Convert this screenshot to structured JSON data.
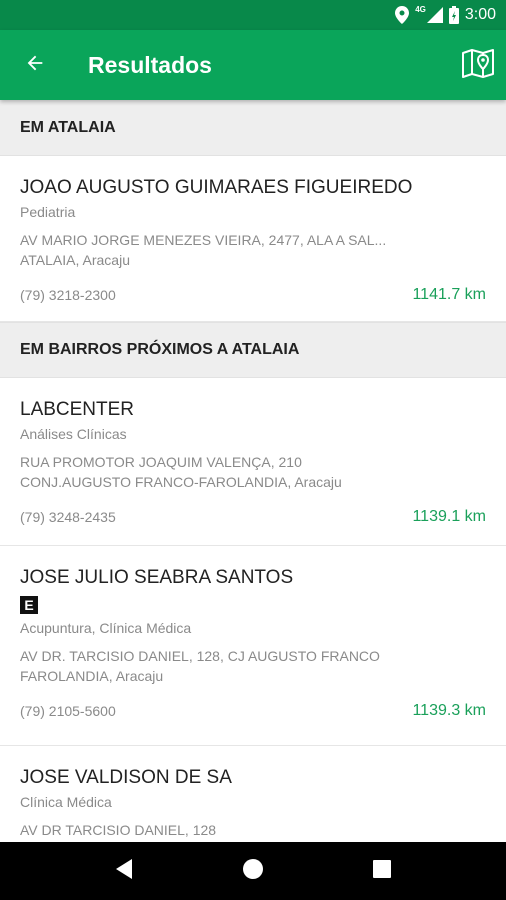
{
  "status_bar": {
    "time": "3:00",
    "network": "4G"
  },
  "app_bar": {
    "title": "Resultados",
    "back_icon": "arrow-back-icon",
    "map_icon": "map-icon",
    "color": "#0aa55a"
  },
  "sections": [
    {
      "header": "EM ATALAIA",
      "items": [
        {
          "name": "JOAO AUGUSTO GUIMARAES FIGUEIREDO",
          "specialty": "Pediatria",
          "address_line1": "AV MARIO JORGE MENEZES VIEIRA, 2477, ALA A     SAL...",
          "address_line2": "ATALAIA, Aracaju",
          "phone": "(79) 3218-2300",
          "distance": "1141.7 km"
        }
      ]
    },
    {
      "header": "EM BAIRROS PRÓXIMOS A ATALAIA",
      "items": [
        {
          "name": "LABCENTER",
          "specialty": "Análises Clínicas",
          "address_line1": "RUA PROMOTOR JOAQUIM VALENÇA, 210",
          "address_line2": "CONJ.AUGUSTO FRANCO-FAROLANDIA, Aracaju",
          "phone": "(79) 3248-2435",
          "distance": "1139.1 km"
        },
        {
          "name": "JOSE JULIO SEABRA SANTOS",
          "badge": "E",
          "specialty": "Acupuntura, Clínica Médica",
          "address_line1": "AV DR. TARCISIO DANIEL, 128, CJ AUGUSTO FRANCO",
          "address_line2": "FAROLANDIA, Aracaju",
          "phone": "(79) 2105-5600",
          "distance": "1139.3 km"
        },
        {
          "name": "JOSE VALDISON DE SA",
          "specialty": "Clínica Médica",
          "address_line1": "AV DR TARCISIO DANIEL, 128"
        }
      ]
    }
  ],
  "nav_bar": {
    "back_icon": "nav-back-icon",
    "home_icon": "nav-home-icon",
    "recents_icon": "nav-recents-icon"
  }
}
